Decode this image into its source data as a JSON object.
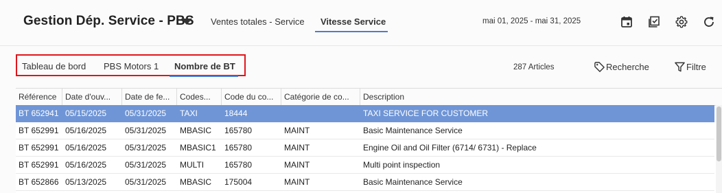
{
  "header": {
    "app_title": "Gestion Dép. Service - PBS",
    "tabs": [
      {
        "label": "Ventes totales - Service"
      },
      {
        "label": "Vitesse Service"
      }
    ],
    "date_range": "mai 01, 2025 - mai 31, 2025",
    "icons": [
      "calendar-icon",
      "checklist-icon",
      "gear-icon",
      "refresh-icon"
    ]
  },
  "toolbar": {
    "subtabs": [
      {
        "label": "Tableau de bord"
      },
      {
        "label": "PBS Motors 1"
      },
      {
        "label": "Nombre de BT"
      }
    ],
    "article_count": "287 Articles",
    "search_label": "Recherche",
    "filter_label": "Filtre"
  },
  "table": {
    "columns": [
      "Référence",
      "Date d'ouv...",
      "Date de fe...",
      "Codes...",
      "Code du co...",
      "Catégorie de co...",
      "Description"
    ],
    "rows": [
      [
        "BT 652941",
        "05/15/2025",
        "05/31/2025",
        "TAXI",
        "18444",
        "",
        "TAXI SERVICE FOR CUSTOMER"
      ],
      [
        "BT 652991",
        "05/16/2025",
        "05/31/2025",
        "MBASIC",
        "165780",
        "MAINT",
        "Basic Maintenance Service"
      ],
      [
        "BT 652991",
        "05/16/2025",
        "05/31/2025",
        "MBASIC1",
        "165780",
        "MAINT",
        "Engine Oil and Oil Filter (6714/ 6731) - Replace"
      ],
      [
        "BT 652991",
        "05/16/2025",
        "05/31/2025",
        "MULTI",
        "165780",
        "MAINT",
        "Multi point inspection"
      ],
      [
        "BT 652866",
        "05/13/2025",
        "05/31/2025",
        "MBASIC",
        "175004",
        "MAINT",
        "Basic Maintenance Service"
      ]
    ],
    "selected_row": 0
  },
  "colors": {
    "accent": "#4d7bd1",
    "selected_row": "#6f95d6",
    "highlight_box": "#e0141b"
  }
}
